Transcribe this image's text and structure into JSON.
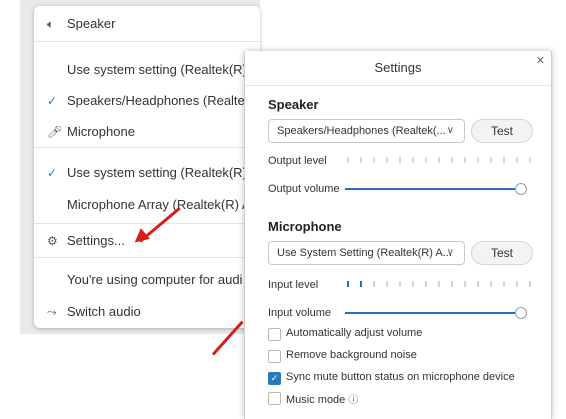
{
  "audio_menu": {
    "speaker_header": "Speaker",
    "speaker_options": [
      "Use system setting (Realtek(R)",
      "Speakers/Headphones (Realtek"
    ],
    "speaker_selected_index": 1,
    "microphone_header": "Microphone",
    "microphone_options": [
      "Use system setting (Realtek(R)",
      "Microphone Array (Realtek(R) A"
    ],
    "microphone_selected_index": 0,
    "settings_label": "Settings...",
    "using_computer_text": "You're using computer for audi",
    "switch_audio_label": "Switch audio"
  },
  "settings_dialog": {
    "title": "Settings",
    "speaker": {
      "heading": "Speaker",
      "device_value": "Speakers/Headphones (Realtek(...",
      "test_label": "Test",
      "output_level_label": "Output level",
      "output_level_fraction": 0,
      "output_volume_label": "Output volume",
      "output_volume_fraction": 1.0
    },
    "microphone": {
      "heading": "Microphone",
      "device_value": "Use System Setting (Realtek(R) A...",
      "test_label": "Test",
      "input_level_label": "Input level",
      "input_level_fraction": 0.13,
      "input_volume_label": "Input volume",
      "input_volume_fraction": 1.0
    },
    "options": [
      {
        "label": "Automatically adjust volume",
        "checked": false
      },
      {
        "label": "Remove background noise",
        "checked": false
      },
      {
        "label": "Sync mute button status on microphone device",
        "checked": true
      },
      {
        "label": "Music mode",
        "checked": false
      }
    ]
  },
  "colors": {
    "accent": "#2a6fb6",
    "arrow": "#d0211c"
  }
}
